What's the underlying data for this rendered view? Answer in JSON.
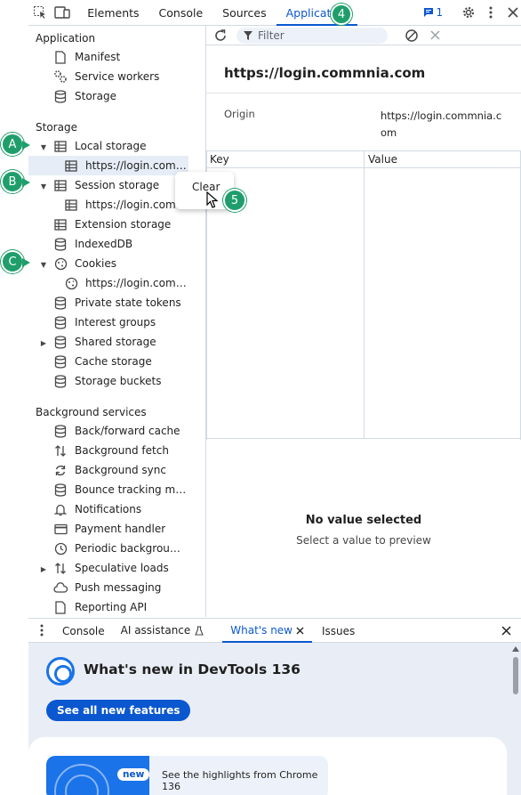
{
  "topbar": {
    "tabs": [
      "Elements",
      "Console",
      "Sources",
      "Application"
    ],
    "active_tab": "Application",
    "issues_count": "1"
  },
  "sidebar": {
    "sections": {
      "application": "Application",
      "storage": "Storage",
      "background": "Background services"
    },
    "application_items": [
      "Manifest",
      "Service workers",
      "Storage"
    ],
    "storage_items": {
      "local_storage": "Local storage",
      "local_origin": "https://login.commnia.com",
      "session_storage": "Session storage",
      "session_origin": "https://login.commnia.com",
      "extension_storage": "Extension storage",
      "indexeddb": "IndexedDB",
      "cookies": "Cookies",
      "cookies_origin": "https://login.comm...",
      "private_state_tokens": "Private state tokens",
      "interest_groups": "Interest groups",
      "shared_storage": "Shared storage",
      "cache_storage": "Cache storage",
      "storage_buckets": "Storage buckets"
    },
    "background_items": [
      "Back/forward cache",
      "Background fetch",
      "Background sync",
      "Bounce tracking miti...",
      "Notifications",
      "Payment handler",
      "Periodic background ...",
      "Speculative loads",
      "Push messaging",
      "Reporting API"
    ]
  },
  "main": {
    "filter_placeholder": "Filter",
    "origin_title": "https://login.commnia.com",
    "origin_label": "Origin",
    "origin_value": "https://login.commnia.com",
    "col_key": "Key",
    "col_value": "Value",
    "no_value": "No value selected",
    "no_value_sub": "Select a value to preview"
  },
  "context_menu": {
    "clear": "Clear"
  },
  "callouts": {
    "a": "A",
    "b": "B",
    "c": "C",
    "four": "4",
    "five": "5"
  },
  "drawer": {
    "tabs": [
      "Console",
      "AI assistance",
      "What's new",
      "Issues"
    ],
    "active_tab": "What's new",
    "title": "What's new in DevTools 136",
    "button": "See all new features",
    "card_badge": "new",
    "card_text": "See the highlights from Chrome 136"
  },
  "colors": {
    "accent": "#0b57d0",
    "callout": "#1f9e6b",
    "drawer_bg": "#e9eef6"
  }
}
